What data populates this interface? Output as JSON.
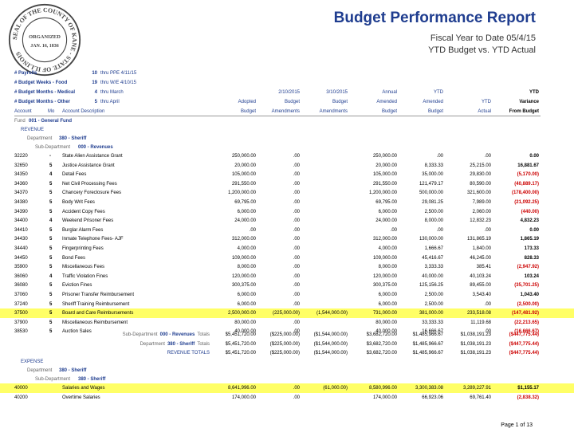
{
  "seal": {
    "text": "SEAL OF THE COUNTY OF KANE - STATE OF ILLINOIS",
    "center1": "ORGANIZED",
    "center2": "JAN. 16, 1836"
  },
  "report": {
    "title": "Budget Performance Report",
    "sub1": "Fiscal Year to Date 05/4/15",
    "sub2": "YTD Budget vs. YTD Actual"
  },
  "params": [
    {
      "label": "# Payrolls",
      "num": "10",
      "desc": "thru PPE 4/11/15"
    },
    {
      "label": "# Budget Weeks - Food",
      "num": "19",
      "desc": "thru W/E 4/10/15"
    },
    {
      "label": "# Budget Months - Medical",
      "num": "4",
      "desc": "thru March"
    },
    {
      "label": "# Budget Months - Other",
      "num": "5",
      "desc": "thru April"
    }
  ],
  "colhead": {
    "l1": [
      "2/10/2015",
      "3/10/2015",
      "Annual",
      "YTD",
      "",
      "YTD"
    ],
    "l2": [
      "Adopted",
      "Budget",
      "Budget",
      "Amended",
      "Amended",
      "YTD",
      "Variance"
    ],
    "l3": [
      "Budget",
      "Amendments",
      "Amendments",
      "Budget",
      "Budget",
      "Actual",
      "From Budget"
    ],
    "account": "Account",
    "mo": "Mo",
    "desc": "Account Description"
  },
  "groups": {
    "fund_label": "Fund",
    "fund_value": "001 - General Fund",
    "revenue": "REVENUE",
    "dept_label": "Department",
    "dept_value": "380 - Sheriff",
    "subdept_label": "Sub-Department",
    "subdept_value": "000 - Revenues",
    "expense": "EXPENSE",
    "subdept2_value": "380 - Sheriff"
  },
  "rows": [
    {
      "acct": "32220",
      "mo": "-",
      "desc": "State Alien Assistance Grant",
      "adopted": "250,000.00",
      "a1": ".00",
      "a2": "",
      "amended": "250,000.00",
      "ytdb": ".00",
      "ytda": ".00",
      "var": "0.00",
      "neg": false,
      "hl": false
    },
    {
      "acct": "32650",
      "mo": "5",
      "desc": "Justice Assistance Grant",
      "adopted": "20,000.00",
      "a1": ".00",
      "a2": "",
      "amended": "20,000.00",
      "ytdb": "8,333.33",
      "ytda": "25,215.00",
      "var": "16,881.67",
      "neg": false,
      "hl": false
    },
    {
      "acct": "34350",
      "mo": "4",
      "desc": "Detail Fees",
      "adopted": "105,000.00",
      "a1": ".00",
      "a2": "",
      "amended": "105,000.00",
      "ytdb": "35,000.00",
      "ytda": "29,830.00",
      "var": "(5,170.00)",
      "neg": true,
      "hl": false
    },
    {
      "acct": "34360",
      "mo": "5",
      "desc": "Net Civil Processing Fees",
      "adopted": "291,550.00",
      "a1": ".00",
      "a2": "",
      "amended": "291,550.00",
      "ytdb": "121,479.17",
      "ytda": "80,590.00",
      "var": "(40,889.17)",
      "neg": true,
      "hl": false
    },
    {
      "acct": "34370",
      "mo": "5",
      "desc": "Chancery Foreclosure Fees",
      "adopted": "1,200,000.00",
      "a1": ".00",
      "a2": "",
      "amended": "1,200,000.00",
      "ytdb": "500,000.00",
      "ytda": "321,600.00",
      "var": "(178,400.00)",
      "neg": true,
      "hl": false
    },
    {
      "acct": "34380",
      "mo": "5",
      "desc": "Body Writ Fees",
      "adopted": "69,795.00",
      "a1": ".00",
      "a2": "",
      "amended": "69,795.00",
      "ytdb": "29,081.25",
      "ytda": "7,989.00",
      "var": "(21,092.25)",
      "neg": true,
      "hl": false
    },
    {
      "acct": "34390",
      "mo": "5",
      "desc": "Accident Copy Fees",
      "adopted": "6,000.00",
      "a1": ".00",
      "a2": "",
      "amended": "6,000.00",
      "ytdb": "2,500.00",
      "ytda": "2,060.00",
      "var": "(440.00)",
      "neg": true,
      "hl": false
    },
    {
      "acct": "34400",
      "mo": "4",
      "desc": "Weekend Prisoner Fees",
      "adopted": "24,000.00",
      "a1": ".00",
      "a2": "",
      "amended": "24,000.00",
      "ytdb": "8,000.00",
      "ytda": "12,832.23",
      "var": "4,832.23",
      "neg": false,
      "hl": false
    },
    {
      "acct": "34410",
      "mo": "5",
      "desc": "Burglar Alarm Fees",
      "adopted": ".00",
      "a1": ".00",
      "a2": "",
      "amended": ".00",
      "ytdb": ".00",
      "ytda": ".00",
      "var": "0.00",
      "neg": false,
      "hl": false
    },
    {
      "acct": "34430",
      "mo": "5",
      "desc": "Inmate Telephone Fees- AJF",
      "adopted": "312,000.00",
      "a1": ".00",
      "a2": "",
      "amended": "312,000.00",
      "ytdb": "130,000.00",
      "ytda": "131,865.19",
      "var": "1,865.19",
      "neg": false,
      "hl": false
    },
    {
      "acct": "34440",
      "mo": "5",
      "desc": "Fingerprinting Fees",
      "adopted": "4,000.00",
      "a1": ".00",
      "a2": "",
      "amended": "4,000.00",
      "ytdb": "1,666.67",
      "ytda": "1,840.00",
      "var": "173.33",
      "neg": false,
      "hl": false
    },
    {
      "acct": "34450",
      "mo": "5",
      "desc": "Bond Fees",
      "adopted": "109,000.00",
      "a1": ".00",
      "a2": "",
      "amended": "109,000.00",
      "ytdb": "45,416.67",
      "ytda": "46,245.00",
      "var": "828.33",
      "neg": false,
      "hl": false
    },
    {
      "acct": "35900",
      "mo": "5",
      "desc": "Miscellaneous Fees",
      "adopted": "8,000.00",
      "a1": ".00",
      "a2": "",
      "amended": "8,000.00",
      "ytdb": "3,333.33",
      "ytda": "385.41",
      "var": "(2,947.92)",
      "neg": true,
      "hl": false
    },
    {
      "acct": "36060",
      "mo": "4",
      "desc": "Traffic Violation Fines",
      "adopted": "120,000.00",
      "a1": ".00",
      "a2": "",
      "amended": "120,000.00",
      "ytdb": "40,000.00",
      "ytda": "40,103.24",
      "var": "103.24",
      "neg": false,
      "hl": false
    },
    {
      "acct": "36080",
      "mo": "5",
      "desc": "Eviction Fines",
      "adopted": "300,375.00",
      "a1": ".00",
      "a2": "",
      "amended": "300,375.00",
      "ytdb": "125,156.25",
      "ytda": "89,455.00",
      "var": "(35,701.25)",
      "neg": true,
      "hl": false
    },
    {
      "acct": "37060",
      "mo": "5",
      "desc": "Prisoner Transfer Reimbursement",
      "adopted": "6,000.00",
      "a1": ".00",
      "a2": "",
      "amended": "6,000.00",
      "ytdb": "2,500.00",
      "ytda": "3,543.40",
      "var": "1,043.40",
      "neg": false,
      "hl": false
    },
    {
      "acct": "37240",
      "mo": "5",
      "desc": "Sheriff Training Reimbursement",
      "adopted": "6,000.00",
      "a1": ".00",
      "a2": "",
      "amended": "6,000.00",
      "ytdb": "2,500.00",
      "ytda": ".00",
      "var": "(2,500.00)",
      "neg": true,
      "hl": false
    },
    {
      "acct": "37500",
      "mo": "5",
      "desc": "Board and Care Reimbursements",
      "adopted": "2,500,000.00",
      "a1": "(225,000.00)",
      "a2": "(1,544,000.00)",
      "amended": "731,000.00",
      "ytdb": "381,000.00",
      "ytda": "233,518.08",
      "var": "(147,481.92)",
      "neg": true,
      "hl": true
    },
    {
      "acct": "37900",
      "mo": "5",
      "desc": "Miscellaneous Reimbursement",
      "adopted": "80,000.00",
      "a1": ".00",
      "a2": "",
      "amended": "80,000.00",
      "ytdb": "33,333.33",
      "ytda": "11,119.68",
      "var": "(22,213.65)",
      "neg": true,
      "hl": false
    },
    {
      "acct": "38530",
      "mo": "5",
      "desc": "Auction Sales",
      "adopted": "40,000.00",
      "a1": ".00",
      "a2": "",
      "amended": "40,000.00",
      "ytdb": "16,666.67",
      "ytda": ".00",
      "var": "(16,666.67)",
      "neg": true,
      "hl": false
    }
  ],
  "totals": [
    {
      "label1": "Sub-Department",
      "label2": "000 - Revenues",
      "label3": "Totals",
      "adopted": "$5,451,720.00",
      "a1": "($225,000.00)",
      "a2": "($1,544,000.00)",
      "amended": "$3,682,720.00",
      "ytdb": "$1,485,966.67",
      "ytda": "$1,038,191.23",
      "var": "($447,775.44)"
    },
    {
      "label1": "Department",
      "label2": "380 - Sheriff",
      "label3": "Totals",
      "adopted": "$5,451,720.00",
      "a1": "($225,000.00)",
      "a2": "($1,544,000.00)",
      "amended": "$3,682,720.00",
      "ytdb": "$1,485,966.67",
      "ytda": "$1,038,191.23",
      "var": "($447,775.44)"
    },
    {
      "label1": "",
      "label2": "",
      "label3": "REVENUE TOTALS",
      "adopted": "$5,451,720.00",
      "a1": "($225,000.00)",
      "a2": "($1,544,000.00)",
      "amended": "$3,682,720.00",
      "ytdb": "$1,485,966.67",
      "ytda": "$1,038,191.23",
      "var": "($447,775.44)"
    }
  ],
  "expense_rows": [
    {
      "acct": "40000",
      "mo": "",
      "desc": "Salaries and Wages",
      "adopted": "8,641,996.00",
      "a1": ".00",
      "a2": "(61,000.00)",
      "amended": "8,580,996.00",
      "ytdb": "3,300,383.08",
      "ytda": "3,289,227.91",
      "var": "$1,155.17",
      "neg": false,
      "hl": true
    },
    {
      "acct": "40200",
      "mo": "",
      "desc": "Overtime Salaries",
      "adopted": "174,000.00",
      "a1": ".00",
      "a2": "",
      "amended": "174,000.00",
      "ytdb": "66,923.06",
      "ytda": "69,761.40",
      "var": "(2,838.32)",
      "neg": true,
      "hl": false
    }
  ],
  "footer": "Page 1 of 13"
}
